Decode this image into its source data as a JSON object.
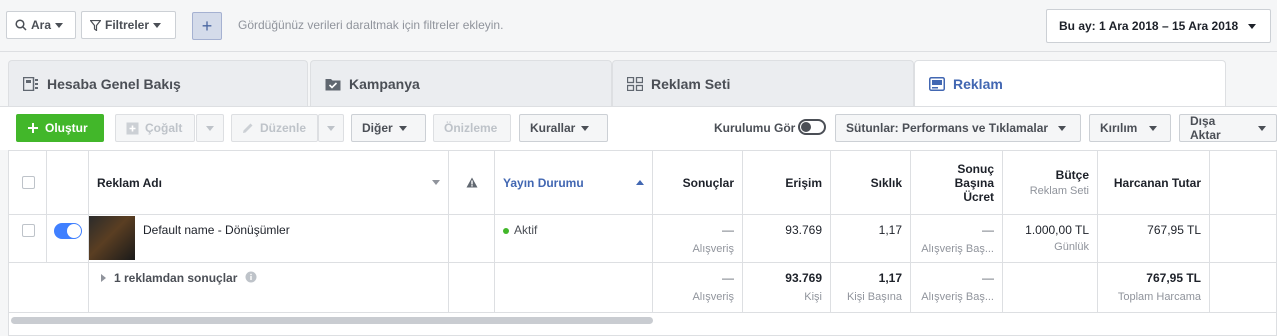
{
  "topbar": {
    "search_label": "Ara",
    "filters_label": "Filtreler",
    "add_symbol": "+",
    "hint": "Gördüğünüz verileri daraltmak için filtreler ekleyin.",
    "date_range": "Bu ay: 1 Ara 2018 – 15 Ara 2018"
  },
  "tabs": [
    {
      "label": "Hesaba Genel Bakış",
      "icon": "overview-icon"
    },
    {
      "label": "Kampanya",
      "icon": "folder-check-icon"
    },
    {
      "label": "Reklam Seti",
      "icon": "grid-icon"
    },
    {
      "label": "Reklam",
      "icon": "ad-icon",
      "active": true
    }
  ],
  "toolbar": {
    "create": "Oluştur",
    "duplicate": "Çoğalt",
    "edit": "Düzenle",
    "more": "Diğer",
    "preview": "Önizleme",
    "rules": "Kurallar",
    "view_setup": "Kurulumu Gör",
    "columns": "Sütunlar: Performans ve Tıklamalar",
    "breakdown": "Kırılım",
    "export": "Dışa Aktar"
  },
  "table": {
    "headers": {
      "name": "Reklam Adı",
      "delivery": "Yayın Durumu",
      "results": "Sonuçlar",
      "reach": "Erişim",
      "frequency": "Sıklık",
      "cost_per_result": "Sonuç Başına Ücret",
      "budget": "Bütçe",
      "budget_sub": "Reklam Seti",
      "spent": "Harcanan Tutar"
    },
    "row": {
      "name": "Default name - Dönüşümler",
      "delivery": "Aktif",
      "results": "—",
      "results_sub": "Alışveriş",
      "reach": "93.769",
      "frequency": "1,17",
      "cost": "—",
      "cost_sub": "Alışveriş Baş...",
      "budget": "1.000,00 TL",
      "budget_sub": "Günlük",
      "spent": "767,95 TL"
    },
    "summary": {
      "label": "1 reklamdan sonuçlar",
      "results": "—",
      "results_sub": "Alışveriş",
      "reach": "93.769",
      "reach_sub": "Kişi",
      "frequency": "1,17",
      "frequency_sub": "Kişi Başına",
      "cost": "—",
      "cost_sub": "Alışveriş Baş...",
      "spent": "767,95 TL",
      "spent_sub": "Toplam Harcama"
    }
  },
  "colors": {
    "accent": "#4267b2",
    "create": "#42b72a",
    "active_dot": "#42b72a",
    "toggle_on": "#4080ff"
  }
}
